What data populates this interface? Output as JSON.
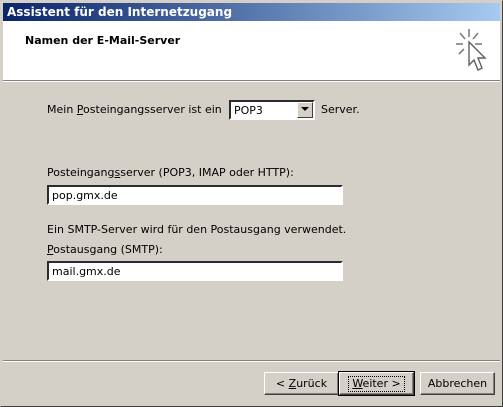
{
  "window": {
    "title": "Assistent für den Internetzugang"
  },
  "header": {
    "page_title": "Namen der E-Mail-Server",
    "icon": "wizard-sparkle-cursor-icon"
  },
  "form": {
    "incoming_type_prefix": "Mein ",
    "incoming_type_access": "P",
    "incoming_type_rest": "osteingangsserver ist ein",
    "incoming_type_select": {
      "value": "POP3"
    },
    "incoming_type_suffix": "Server.",
    "incoming_server_label_a": "Posteingang",
    "incoming_server_label_access": "s",
    "incoming_server_label_b": "server (POP3, IMAP oder HTTP):",
    "incoming_server_value": "pop.gmx.de",
    "smtp_note": "Ein SMTP-Server wird für den Postausgang verwendet.",
    "outgoing_label_access": "P",
    "outgoing_label_rest": "ostausgang (SMTP):",
    "outgoing_value": "mail.gmx.de"
  },
  "buttons": {
    "back_prefix": "< ",
    "back_access": "Z",
    "back_rest": "urück",
    "next_access": "W",
    "next_rest": "eiter >",
    "cancel": "Abbrechen"
  },
  "colors": {
    "dialog_face": "#d4d0c8",
    "titlebar_start": "#0a246a",
    "titlebar_end": "#a6caf0",
    "header_bg": "#ffffff"
  }
}
